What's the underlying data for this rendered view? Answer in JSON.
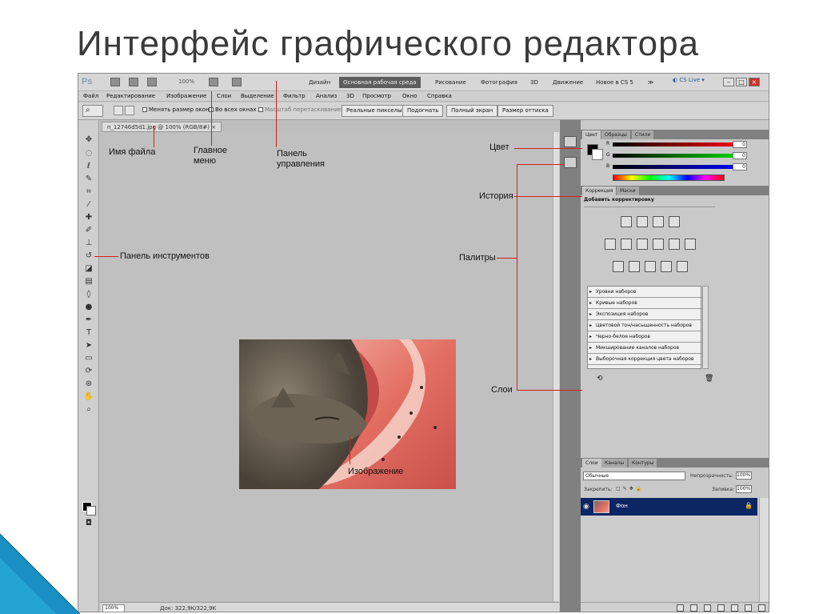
{
  "slide": {
    "title": "Интерфейс графического редактора"
  },
  "app": {
    "logo": "Ps",
    "zoom": "100%",
    "workspaces": [
      "Дизайн",
      "Основная рабочая среда",
      "Рисование",
      "Фотография",
      "3D",
      "Движение",
      "Новое в CS 5",
      "≫"
    ],
    "active_workspace": "Основная рабочая среда",
    "cslive": "CS Live",
    "menu": [
      "Файл",
      "Редактирование",
      "Изображение",
      "Слои",
      "Выделение",
      "Фильтр",
      "Анализ",
      "3D",
      "Просмотр",
      "Окно",
      "Справка"
    ],
    "options": {
      "check1": "Менять размер окон",
      "check2": "Во всех окнах",
      "check3": "Масштаб перетаскиванием",
      "buttons": [
        "Реальные пикселы",
        "Подогнать",
        "Полный экран",
        "Размер оттиска"
      ]
    },
    "document": {
      "tab": "n_12746d5d1.jpg @ 100% (RGB/8#)",
      "status_zoom": "100%",
      "status_doc": "Док: 322,9K/322,9K"
    },
    "color_panel": {
      "tabs": [
        "Цвет",
        "Образцы",
        "Стили"
      ],
      "channels": [
        {
          "label": "R",
          "value": "0"
        },
        {
          "label": "G",
          "value": "0"
        },
        {
          "label": "B",
          "value": "0"
        }
      ]
    },
    "adjustments_panel": {
      "tabs": [
        "Коррекция",
        "Маски"
      ],
      "heading": "Добавить корректировку",
      "presets": [
        "Уровни наборов",
        "Кривые наборов",
        "Экспозиция наборов",
        "Цветовой тон/насыщенность наборов",
        "Черно-белое наборов",
        "Микширование каналов наборов",
        "Выборочная коррекция цвета наборов"
      ]
    },
    "layers_panel": {
      "tabs": [
        "Слои",
        "Каналы",
        "Контуры"
      ],
      "blend_mode": "Обычные",
      "opacity_label": "Непрозрачность:",
      "opacity": "100%",
      "lock_label": "Закрепить:",
      "fill_label": "Заливка:",
      "fill": "100%",
      "layer_name": "Фон"
    }
  },
  "annotations": {
    "file_name": "Имя файла",
    "main_menu": "Главное меню",
    "control_panel": "Панель управления",
    "toolbar": "Панель инструментов",
    "color": "Цвет",
    "history": "История",
    "palettes": "Палитры",
    "layers": "Слои",
    "image": "Изображение"
  },
  "colors": {
    "annotation_line": "#d21f1f",
    "active_workspace": "#5d5d5d",
    "selected_layer": "#0c2663",
    "slide_accent": "#1a8fc4"
  }
}
